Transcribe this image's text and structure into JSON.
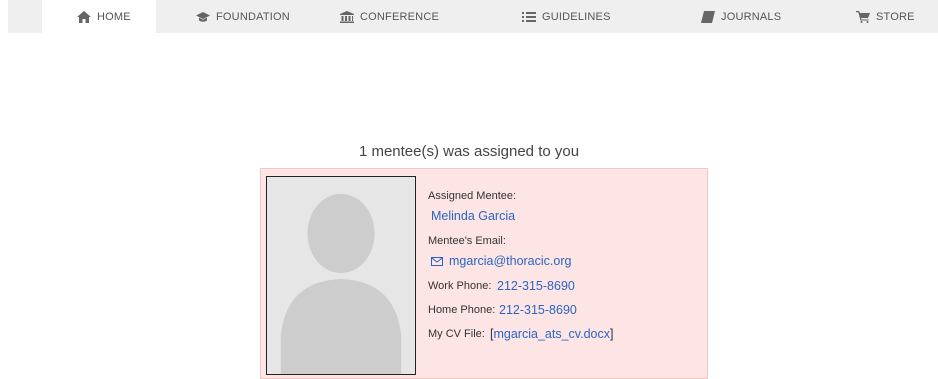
{
  "nav": {
    "items": [
      {
        "label": "HOME",
        "icon": "home-icon"
      },
      {
        "label": "FOUNDATION",
        "icon": "graduation-cap-icon"
      },
      {
        "label": "CONFERENCE",
        "icon": "institution-icon"
      },
      {
        "label": "GUIDELINES",
        "icon": "list-icon"
      },
      {
        "label": "JOURNALS",
        "icon": "book-icon"
      },
      {
        "label": "STORE",
        "icon": "cart-icon"
      }
    ],
    "active_index": 0
  },
  "page": {
    "title": "1 mentee(s) was assigned to you"
  },
  "mentee": {
    "assigned_label": "Assigned Mentee:",
    "name": "Melinda Garcia",
    "email_label": "Mentee's Email:",
    "email": "mgarcia@thoracic.org",
    "work_phone_label": "Work Phone:",
    "work_phone": "212-315-8690",
    "home_phone_label": "Home Phone:",
    "home_phone": "212-315-8690",
    "cv_label": "My CV File:",
    "cv_open_bracket": "[",
    "cv_file": "mgarcia_ats_cv.docx",
    "cv_close_bracket": "]"
  },
  "colors": {
    "card_background": "#fde5e5",
    "link": "#2a65c0",
    "nav_background": "#efefef"
  }
}
